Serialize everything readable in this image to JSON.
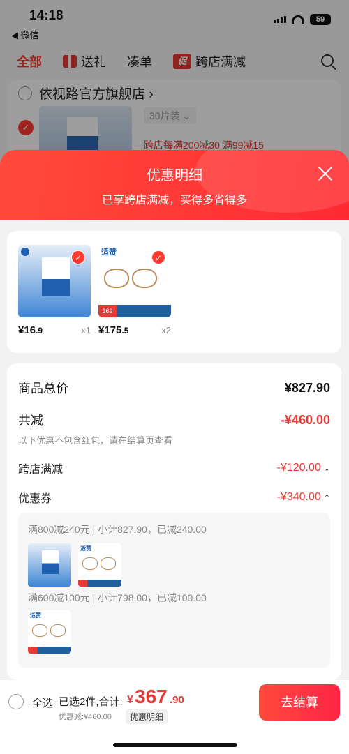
{
  "status": {
    "time": "14:18",
    "back_app": "◀ 微信",
    "battery": "59"
  },
  "tabs": {
    "all": "全部",
    "gift": "送礼",
    "bundle": "凑单",
    "promo_icon": "促",
    "cross_store": "跨店满减"
  },
  "shop": {
    "name": "依视路官方旗舰店 ›",
    "spec": "30片装 ⌄",
    "promo": "跨店每满200减30  满99减15"
  },
  "modal": {
    "title": "优惠明细",
    "subtitle": "已享跨店满减，买得多省得多"
  },
  "products": [
    {
      "price_int": "¥16",
      "price_dec": ".9",
      "qty": "x1"
    },
    {
      "price_int": "¥175",
      "price_dec": ".5",
      "qty": "x2",
      "brand": "适赞",
      "badge": "369"
    }
  ],
  "breakdown": {
    "total_label": "商品总价",
    "total_value": "¥827.90",
    "discount_label": "共减",
    "discount_value": "-¥460.00",
    "note": "以下优惠不包含红包，请在结算页查看",
    "cross_label": "跨店满减",
    "cross_value": "-¥120.00",
    "coupon_label": "优惠券",
    "coupon_value": "-¥340.00",
    "coupon_line1": "满800减240元 | 小计827.90，已减240.00",
    "coupon_line2": "满600减100元 | 小计798.00，已减100.00"
  },
  "bottom": {
    "select_all": "全选",
    "selected": "已选2件,合计:",
    "currency": "¥",
    "total_int": "367",
    "total_dec": ".90",
    "discount_text": "优惠减:¥460.00",
    "detail_pill": "优惠明细",
    "checkout": "去结算"
  },
  "colors": {
    "accent_red": "#e53935",
    "header_red": "#ff3b30"
  }
}
